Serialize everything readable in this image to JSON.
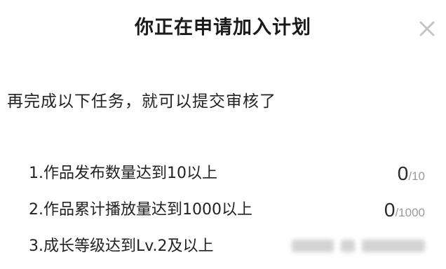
{
  "dialog": {
    "title": "你正在申请加入计划",
    "close_icon": "close-icon",
    "subtitle": "再完成以下任务，就可以提交审核了",
    "tasks": [
      {
        "label": "1.作品发布数量达到10以上",
        "current": "0",
        "separator": "/",
        "total": "10"
      },
      {
        "label": "2.作品累计播放量达到1000以上",
        "current": "0",
        "separator": "/",
        "total": "1000"
      },
      {
        "label": "3.成长等级达到Lv.2及以上"
      }
    ]
  }
}
